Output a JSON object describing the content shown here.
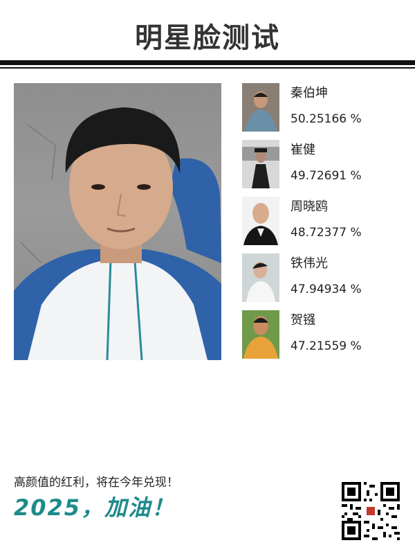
{
  "header": {
    "title": "明星脸测试"
  },
  "matches": [
    {
      "name": "秦伯坤",
      "score": "50.25166 %"
    },
    {
      "name": "崔健",
      "score": "49.72691 %"
    },
    {
      "name": "周晓鸥",
      "score": "48.72377 %"
    },
    {
      "name": "铁伟光",
      "score": "47.94934 %"
    },
    {
      "name": "贺镪",
      "score": "47.21559 %"
    }
  ],
  "footer": {
    "slogan": "高颜值的红利，将在今年兑现！",
    "cheer": "2025，加油！"
  },
  "colors": {
    "accent": "#1e8a8a",
    "rule": "#111111"
  }
}
